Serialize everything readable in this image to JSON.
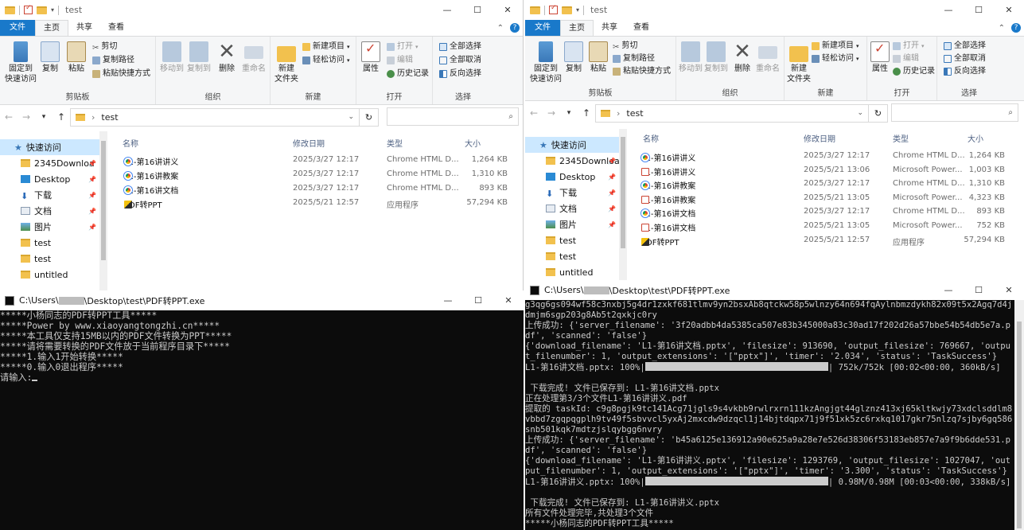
{
  "left_explorer": {
    "title": "test",
    "tabs": [
      "文件",
      "主页",
      "共享",
      "查看"
    ],
    "ribbon": {
      "clipboard": {
        "label": "剪贴板",
        "pin": "固定到\n快速访问",
        "copy": "复制",
        "paste": "粘贴",
        "cut": "剪切",
        "copy_path": "复制路径",
        "paste_shortcut": "粘贴快捷方式"
      },
      "organize": {
        "label": "组织",
        "move_to": "移动到",
        "copy_to": "复制到",
        "delete": "删除",
        "rename": "重命名"
      },
      "new": {
        "label": "新建",
        "new_folder": "新建\n文件夹",
        "new_item": "新建项目",
        "easy_access": "轻松访问"
      },
      "open": {
        "label": "打开",
        "properties": "属性",
        "open": "打开",
        "edit": "编辑",
        "history": "历史记录"
      },
      "select": {
        "label": "选择",
        "select_all": "全部选择",
        "select_none": "全部取消",
        "invert": "反向选择"
      }
    },
    "address": "test",
    "nav": [
      {
        "label": "快速访问",
        "icon": "star-icon"
      },
      {
        "label": "2345Downloa",
        "icon": "folder-icon",
        "pin": "📌"
      },
      {
        "label": "Desktop",
        "icon": "desktop-icon",
        "pin": "📌"
      },
      {
        "label": "下载",
        "icon": "download-icon",
        "pin": "📌"
      },
      {
        "label": "文档",
        "icon": "document-icon",
        "pin": "📌"
      },
      {
        "label": "图片",
        "icon": "picture-icon",
        "pin": "📌"
      },
      {
        "label": "test",
        "icon": "folder-icon"
      },
      {
        "label": "test",
        "icon": "folder-icon"
      },
      {
        "label": "untitled",
        "icon": "folder-icon"
      }
    ],
    "columns": {
      "name": "名称",
      "date": "修改日期",
      "type": "类型",
      "size": "大小"
    },
    "files": [
      {
        "name": "L1-第16讲讲义",
        "date": "2025/3/27 12:17",
        "type": "Chrome HTML D...",
        "size": "1,264 KB",
        "icon": "chrome"
      },
      {
        "name": "L1-第16讲教案",
        "date": "2025/3/27 12:17",
        "type": "Chrome HTML D...",
        "size": "1,310 KB",
        "icon": "chrome"
      },
      {
        "name": "L1-第16讲文档",
        "date": "2025/3/27 12:17",
        "type": "Chrome HTML D...",
        "size": "893 KB",
        "icon": "chrome"
      },
      {
        "name": "PDF转PPT",
        "date": "2025/5/21 12:57",
        "type": "应用程序",
        "size": "57,294 KB",
        "icon": "app"
      }
    ]
  },
  "right_explorer": {
    "title": "test",
    "address": "test",
    "files": [
      {
        "name": "L1-第16讲讲义",
        "date": "2025/3/27 12:17",
        "type": "Chrome HTML D...",
        "size": "1,264 KB",
        "icon": "chrome"
      },
      {
        "name": "L1-第16讲讲义",
        "date": "2025/5/21 13:06",
        "type": "Microsoft Power...",
        "size": "1,003 KB",
        "icon": "ppt"
      },
      {
        "name": "L1-第16讲教案",
        "date": "2025/3/27 12:17",
        "type": "Chrome HTML D...",
        "size": "1,310 KB",
        "icon": "chrome"
      },
      {
        "name": "L1-第16讲教案",
        "date": "2025/5/21 13:05",
        "type": "Microsoft Power...",
        "size": "4,323 KB",
        "icon": "ppt"
      },
      {
        "name": "L1-第16讲文档",
        "date": "2025/3/27 12:17",
        "type": "Chrome HTML D...",
        "size": "893 KB",
        "icon": "chrome"
      },
      {
        "name": "L1-第16讲文档",
        "date": "2025/5/21 13:05",
        "type": "Microsoft Power...",
        "size": "752 KB",
        "icon": "ppt"
      },
      {
        "name": "PDF转PPT",
        "date": "2025/5/21 12:57",
        "type": "应用程序",
        "size": "57,294 KB",
        "icon": "app"
      }
    ]
  },
  "left_console": {
    "title_prefix": "C:\\Users\\",
    "title_suffix": "\\Desktop\\test\\PDF转PPT.exe",
    "lines": [
      "*****小杨同志的PDF转PPT工具*****",
      "*****Power by www.xiaoyangtongzhi.cn*****",
      "*****本工具仅支持15MB以内的PDF文件转换为PPT*****",
      "*****请将需要转换的PDF文件放于当前程序目录下*****",
      "*****1.输入1开始转换*****",
      "*****0.输入0退出程序*****",
      "请输入:"
    ]
  },
  "right_console": {
    "title_prefix": "C:\\Users\\",
    "title_suffix": "\\Desktop\\test\\PDF转PPT.exe",
    "lines": [
      "g3qg6gs094wf58c3nxbj5g4dr1zxkf681tlmv9yn2bsxAb8qtckw58p5wlnzy64n694fqAylnbmzdykh82x09t5x2Agq7d4jdmjm6sgp203g8Ab5t2qxkjc0ry",
      "上传成功: {'server_filename': '3f20adbb4da5385ca507e83b345000a83c30ad17f202d26a57bbe54b54db5e7a.pdf', 'scanned': 'false'}",
      "{'download_filename': 'L1-第16讲文档.pptx', 'filesize': 913690, 'output_filesize': 769667, 'output_filenumber': 1, 'output_extensions': '[\"pptx\"]', 'timer': '2.034', 'status': 'TaskSuccess'}",
      "L1-第16讲文档.pptx: 100%|",
      "| 752k/752k [00:02<00:00, 360kB/s]",
      "",
      " 下载完成! 文件已保存到: L1-第16讲文档.pptx",
      "正在处理第3/3个文件L1-第16讲讲义.pdf",
      "提取的 taskId: c9g8pgjk9tc141Acg71jgls9s4vkbb9rwlrxrn111kzAngjgt44glznz413xj65kltkwjy73xdclsddlm8vbbd7zgqpqgplh9tv49f5sbvvcl5yxAj2mxcdw9dzqcl1j14bjtdqpx71j9f51xk5zc6rxkq1017gkr75nlzq7sjby6gq586snb501kqk7mdtzjslqybgg6nvry",
      "上传成功: {'server_filename': 'b45a6125e136912a90e625a9a28e7e526d38306f53183eb857e7a9f9b6dde531.pdf', 'scanned': 'false'}",
      "{'download_filename': 'L1-第16讲讲义.pptx', 'filesize': 1293769, 'output_filesize': 1027047, 'output_filenumber': 1, 'output_extensions': '[\"pptx\"]', 'timer': '3.300', 'status': 'TaskSuccess'}",
      "L1-第16讲讲义.pptx: 100%|",
      "| 0.98M/0.98M [00:03<00:00, 338kB/s]",
      "",
      " 下载完成! 文件已保存到: L1-第16讲讲义.pptx",
      "所有文件处理完毕,共处理3个文件",
      "*****小杨同志的PDF转PPT工具*****"
    ]
  },
  "window_controls": {
    "min": "—",
    "max": "☐",
    "close": "✕"
  }
}
